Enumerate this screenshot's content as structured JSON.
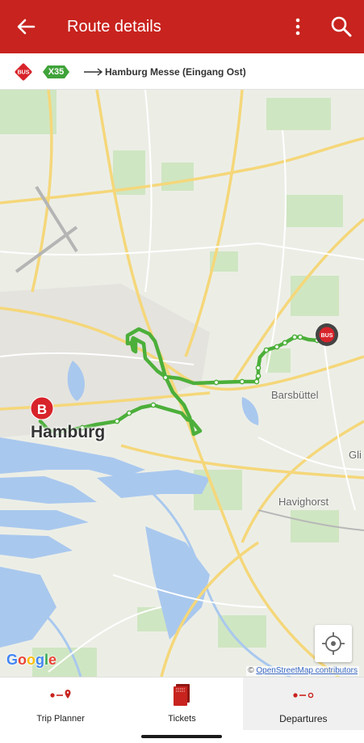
{
  "app_bar": {
    "title": "Route details",
    "background_color": "#c8231e",
    "back_icon": "arrow-back-icon",
    "more_icon": "more-vert-icon",
    "search_icon": "search-icon"
  },
  "route": {
    "mode_badge_text": "BUS",
    "line": "X35",
    "line_color": "#3fa33a",
    "destination": "Hamburg Messe (Eingang Ost)"
  },
  "map": {
    "route_color": "#4caf3a",
    "places": {
      "city": "Hamburg",
      "barsbuettel": "Barsbüttel",
      "havighorst": "Havighorst",
      "glinde_partial": "Gli"
    },
    "start_marker_label": "B",
    "bus_marker_label": "BUS",
    "google_logo": "Google",
    "attribution_prefix": "©",
    "attribution_link": "OpenStreetMap contributors",
    "locate_icon": "my-location-icon"
  },
  "bottom_nav": {
    "tabs": [
      {
        "label": "Trip Planner",
        "icon": "trip-planner-icon",
        "active": false
      },
      {
        "label": "Tickets",
        "icon": "tickets-icon",
        "active": false
      },
      {
        "label": "Departures",
        "icon": "departures-icon",
        "active": true
      }
    ]
  }
}
